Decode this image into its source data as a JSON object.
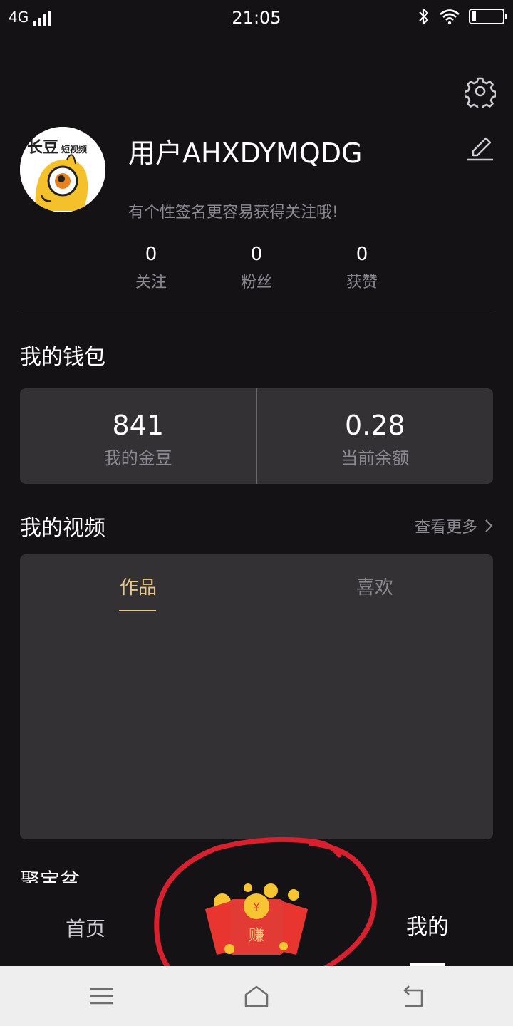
{
  "status_bar": {
    "network": "4G",
    "time": "21:05"
  },
  "profile": {
    "username": "用户AHXDYMQDG",
    "signature": "有个性签名更容易获得关注哦!",
    "avatar": {
      "brand": "长豆",
      "sub": "短视频"
    },
    "stats": [
      {
        "value": "0",
        "label": "关注"
      },
      {
        "value": "0",
        "label": "粉丝"
      },
      {
        "value": "0",
        "label": "获赞"
      }
    ]
  },
  "wallet": {
    "title": "我的钱包",
    "items": [
      {
        "value": "841",
        "label": "我的金豆"
      },
      {
        "value": "0.28",
        "label": "当前余额"
      }
    ]
  },
  "videos": {
    "title": "我的视频",
    "view_more": "查看更多",
    "tabs": [
      {
        "label": "作品",
        "active": true
      },
      {
        "label": "喜欢",
        "active": false
      }
    ]
  },
  "partial_section_title": "聚宝盆",
  "bottom_nav": {
    "home": "首页",
    "earn": "赚",
    "mine": "我的"
  },
  "colors": {
    "background": "#141215",
    "card": "#333134",
    "accent": "#e8c88a",
    "muted": "#8d8a8f",
    "annotation": "#d9202f",
    "earn_red": "#e8352f"
  },
  "icons": [
    "signal-icon",
    "bluetooth-icon",
    "wifi-icon",
    "battery-icon",
    "settings-icon",
    "edit-icon",
    "chevron-right-icon",
    "menu-icon",
    "home-icon",
    "back-icon"
  ]
}
